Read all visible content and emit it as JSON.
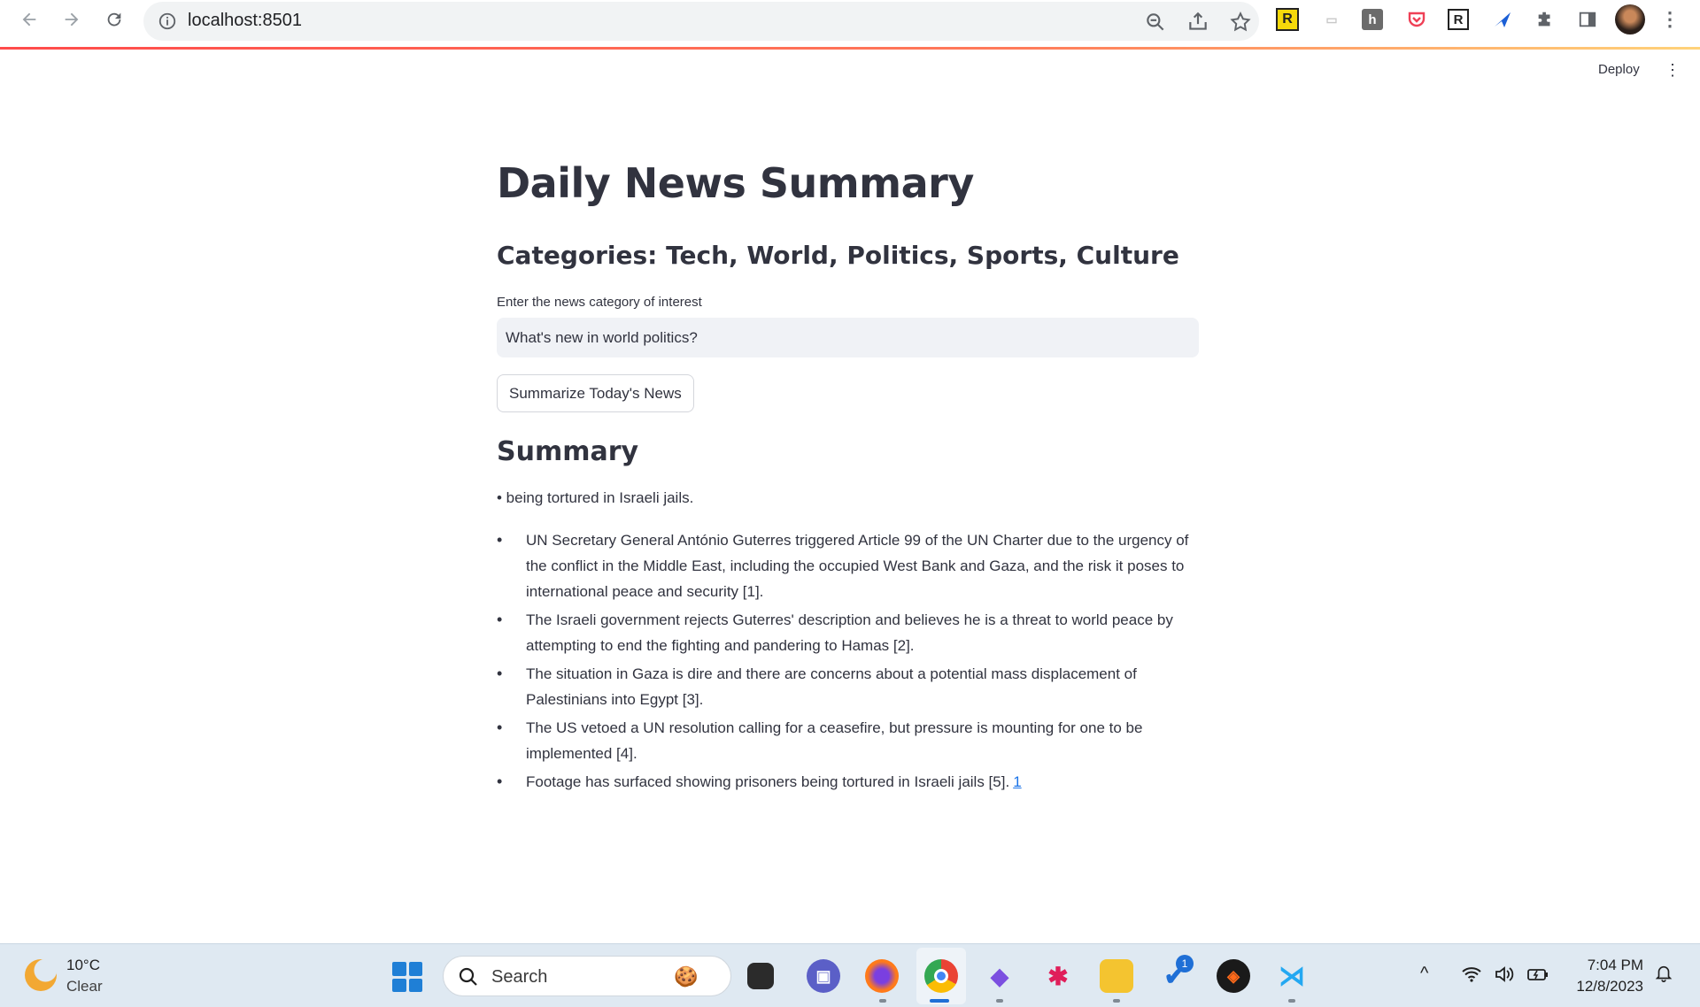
{
  "browser": {
    "url": "localhost:8501"
  },
  "header": {
    "deploy_label": "Deploy",
    "menu_glyph": "⋮"
  },
  "main": {
    "title": "Daily News Summary",
    "subtitle": "Categories: Tech, World, Politics, Sports, Culture",
    "input_label": "Enter the news category of interest",
    "input_value": "What's new in world politics?",
    "button_label": "Summarize Today's News",
    "summary_heading": "Summary",
    "lead_text": "• being tortured in Israeli jails.",
    "bullets": [
      "UN Secretary General António Guterres triggered Article 99 of the UN Charter due to the urgency of the conflict in the Middle East, including the occupied West Bank and Gaza, and the risk it poses to international peace and security [1].",
      "The Israeli government rejects Guterres' description and believes he is a threat to world peace by attempting to end the fighting and pandering to Hamas [2].",
      "The situation in Gaza is dire and there are concerns about a potential mass displacement of Palestinians into Egypt [3].",
      "The US vetoed a UN resolution calling for a ceasefire, but pressure is mounting for one to be implemented [4].",
      "Footage has surfaced showing prisoners being tortured in Israeli jails [5]."
    ],
    "footnote_link": "1"
  },
  "taskbar": {
    "weather_temp": "10°C",
    "weather_desc": "Clear",
    "search_placeholder": "Search",
    "notification_badge": "1",
    "time": "7:04 PM",
    "date": "12/8/2023"
  },
  "colors": {
    "accent": "#ff4b4b",
    "input_bg": "#f0f2f6",
    "text": "#31333f",
    "link": "#1a73e8"
  }
}
